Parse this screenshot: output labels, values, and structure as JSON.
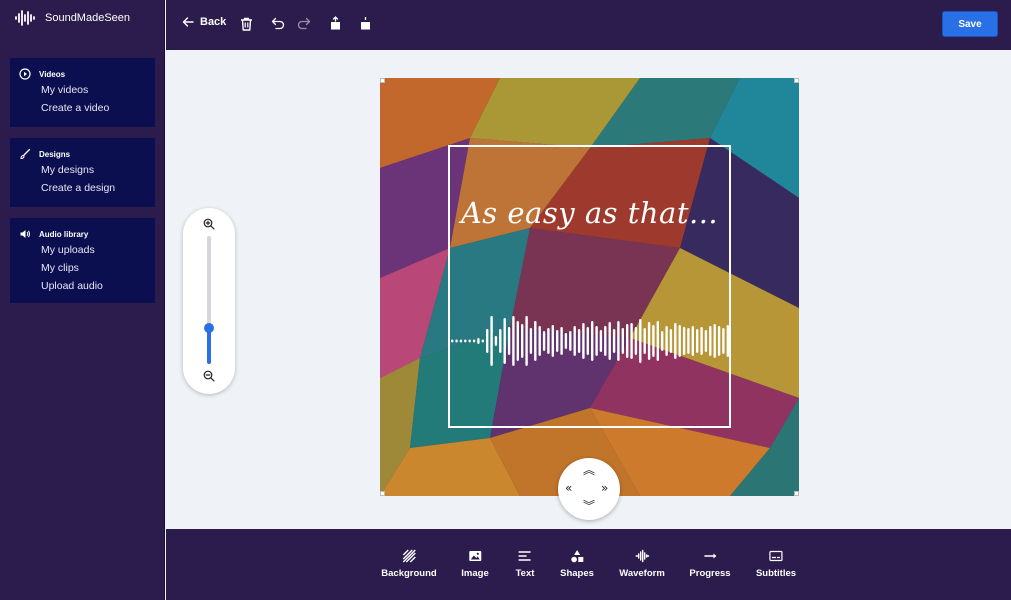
{
  "app": {
    "name": "SoundMadeSeen"
  },
  "sidebar": {
    "groups": [
      {
        "title": "Videos",
        "items": [
          "My videos",
          "Create a video"
        ]
      },
      {
        "title": "Designs",
        "items": [
          "My designs",
          "Create a design"
        ]
      },
      {
        "title": "Audio library",
        "items": [
          "My uploads",
          "My clips",
          "Upload audio"
        ]
      }
    ]
  },
  "toolbar": {
    "back_label": "Back",
    "save_label": "Save"
  },
  "canvas": {
    "headline": "As easy as that..."
  },
  "zoom": {
    "level": 0.28
  },
  "bottom_tools": [
    "Background",
    "Image",
    "Text",
    "Shapes",
    "Waveform",
    "Progress",
    "Subtitles"
  ],
  "colors": {
    "sidebar": "#2c1c4d",
    "nav_group": "#0c0f4f",
    "accent": "#2970e6"
  }
}
